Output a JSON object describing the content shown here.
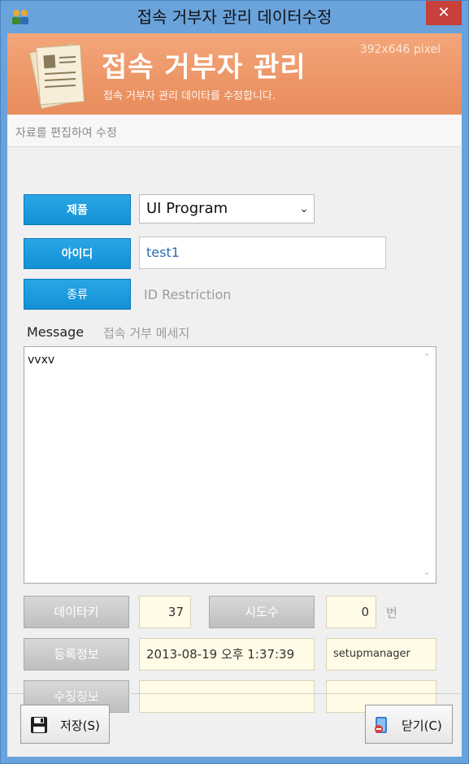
{
  "window": {
    "title": "접속 거부자 관리 데이터수정",
    "close_label": "✕"
  },
  "banner": {
    "title": "접속 거부자 관리",
    "subtitle": "접속 거부자 관리 데이타를 수정합니다.",
    "size_note": "392x646 pixel"
  },
  "hint": "자료를 편집하여 수정",
  "form": {
    "product_label": "제품",
    "product_value": "UI Program",
    "id_label": "아이디",
    "id_value": "test1",
    "type_label": "종류",
    "type_value": "ID Restriction",
    "message_label": "Message",
    "message_hint": "접속 거부 메세지",
    "message_value": "vvxv",
    "datakey_label": "데이타키",
    "datakey_value": "37",
    "attempts_label": "시도수",
    "attempts_value": "0",
    "attempts_unit": "번",
    "reg_label": "등록정보",
    "reg_date": "2013-08-19 오후 1:37:39",
    "reg_user": "setupmanager",
    "mod_label": "수정정보",
    "mod_date": "",
    "mod_user": ""
  },
  "footer": {
    "save_label": "저장(S)",
    "close_label": "닫기(C)"
  },
  "colors": {
    "accent_blue": "#1391d6",
    "banner_orange": "#ec9566",
    "titlebar": "#6aa3dc",
    "close_red": "#c7403a"
  },
  "icons": {
    "app": "app-people-icon",
    "banner": "documents-icon",
    "save": "floppy-disk-icon",
    "close": "exit-door-icon"
  }
}
